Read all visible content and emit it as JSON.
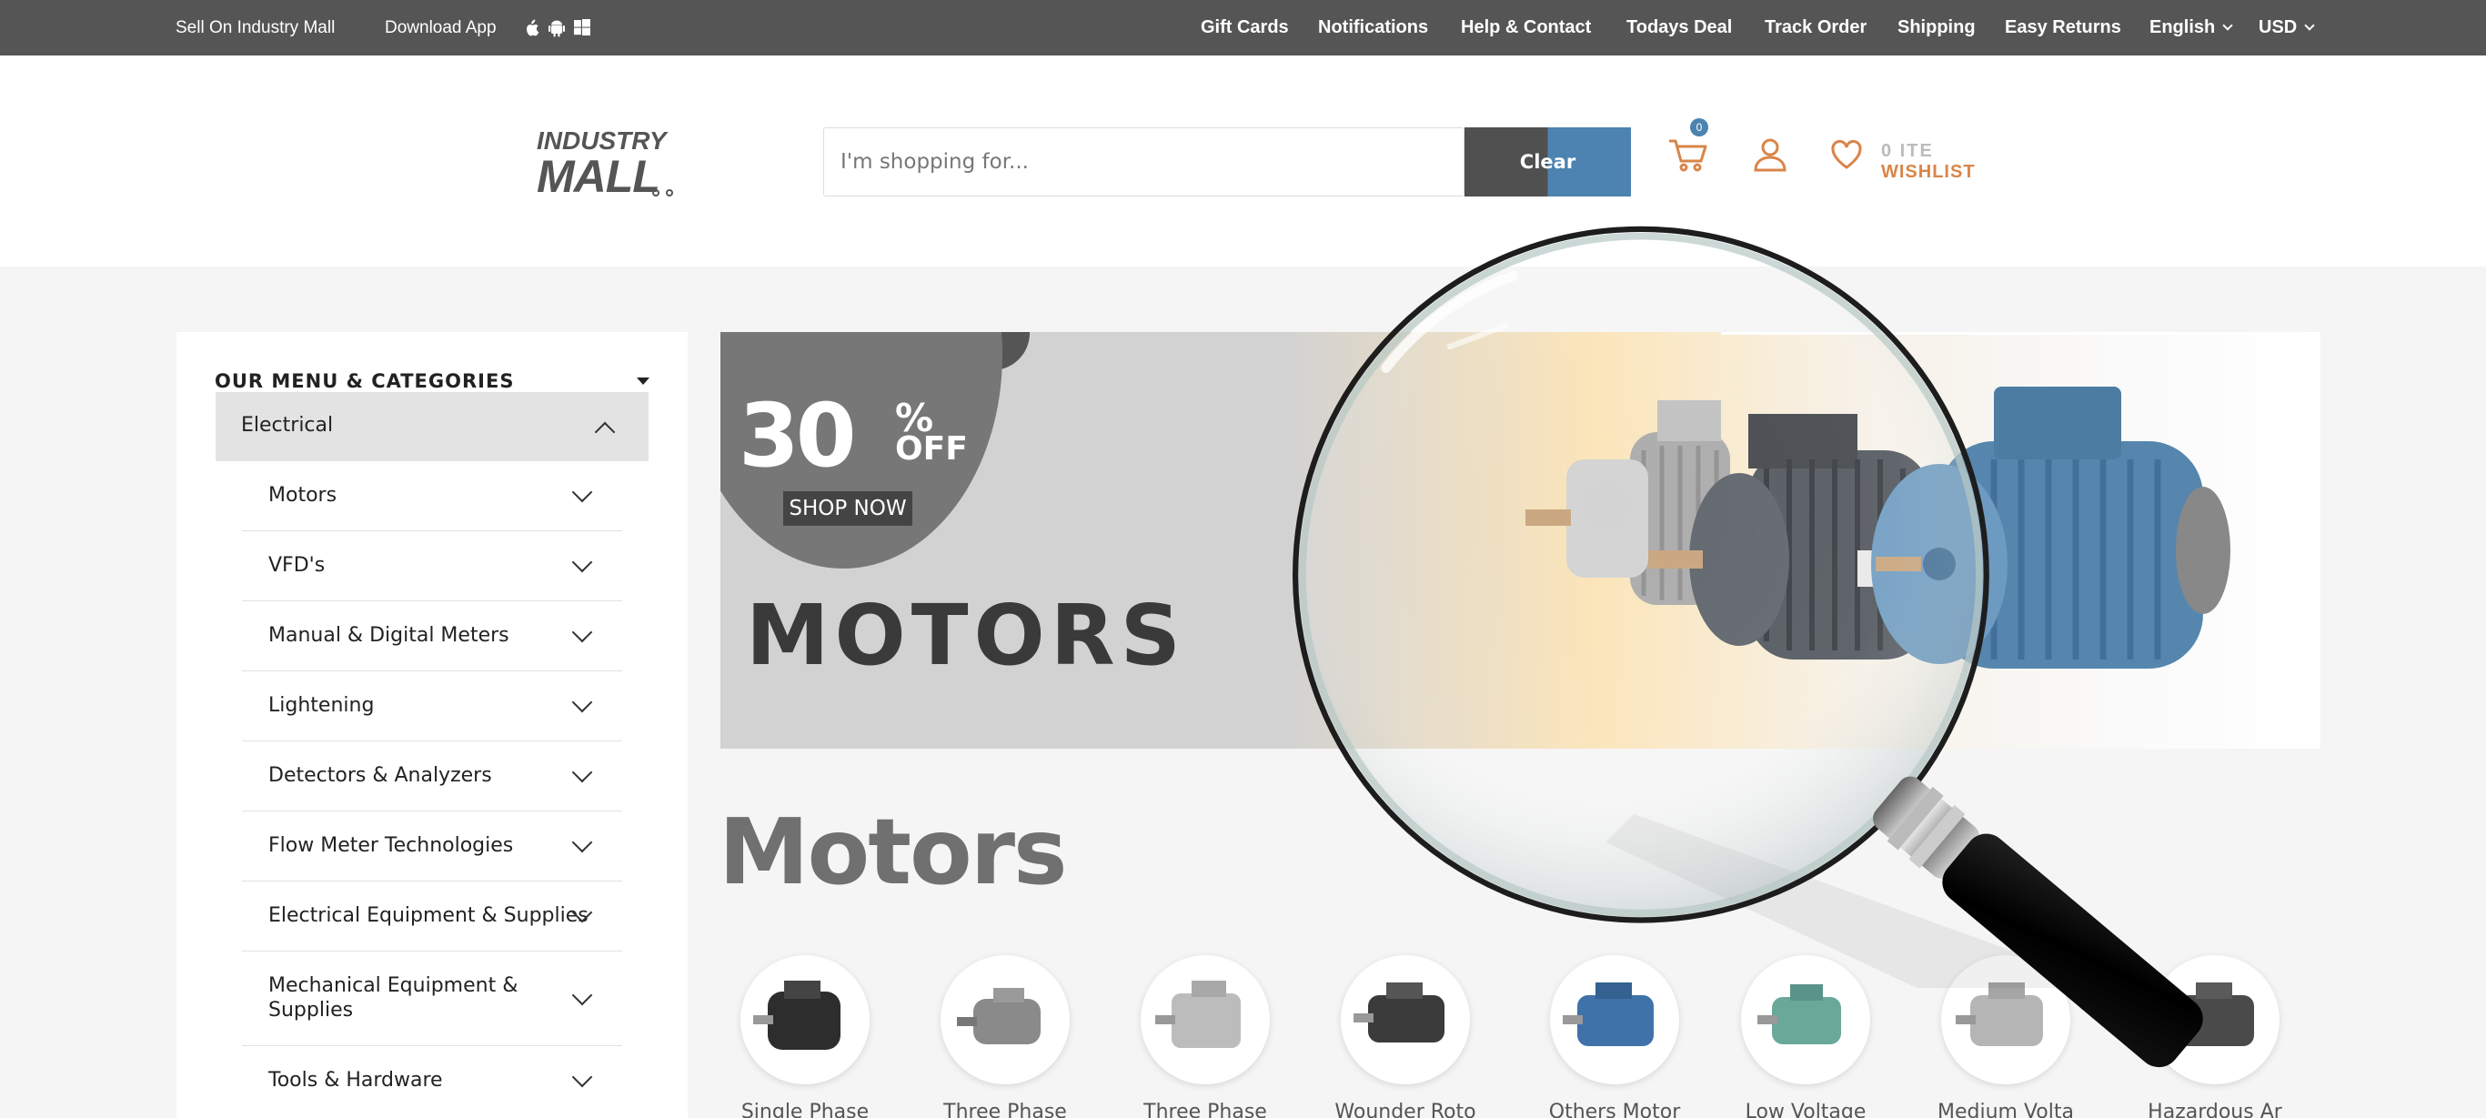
{
  "topbar": {
    "sell": "Sell On Industry Mall",
    "download": "Download App",
    "links": [
      "Gift Cards",
      "Notifications",
      "Help & Contact",
      "Todays Deal",
      "Track Order",
      "Shipping",
      "Easy Returns"
    ],
    "language": "English",
    "currency": "USD"
  },
  "header": {
    "logo_top": "INDUSTRY",
    "logo_bottom": "MALL",
    "search_placeholder": "I'm shopping for...",
    "clear_label": "Clear",
    "cart_count": "0",
    "items_label": "0 ITE",
    "wishlist_label": "WISHLIST"
  },
  "sidebar": {
    "title": "OUR MENU & CATEGORIES",
    "active": "Electrical",
    "items": [
      "Motors",
      "VFD's",
      "Manual & Digital Meters",
      "Lightening",
      "Detectors & Analyzers",
      "Flow Meter Technologies",
      "Electrical Equipment & Supplies",
      "Mechanical Equipment &\nSupplies",
      "Tools & Hardware"
    ]
  },
  "banner": {
    "discount": "30",
    "percent": "%",
    "off": "OFF",
    "shop_now": "SHOP NOW",
    "headline": "MOTORS"
  },
  "section_title": "Motors",
  "categories": [
    {
      "label": "Single Phase",
      "color": "#2d2d2d"
    },
    {
      "label": "Three Phase",
      "color": "#8a8a8a"
    },
    {
      "label": "Three Phase",
      "color": "#9a9a9a"
    },
    {
      "label": "Wounder Roto",
      "color": "#3b3b3b"
    },
    {
      "label": "Others Motor",
      "color": "#3f72a8"
    },
    {
      "label": "Low Voltage",
      "color": "#6aa89a"
    },
    {
      "label": "Medium Volta",
      "color": "#b5b5b5"
    },
    {
      "label": "Hazardous Ar",
      "color": "#4a4a4a"
    }
  ],
  "colors": {
    "topbar_bg": "#555555",
    "accent_blue": "#4c83b0",
    "accent_orange": "#d9854a",
    "banner_bg": "#d2d2d2"
  }
}
